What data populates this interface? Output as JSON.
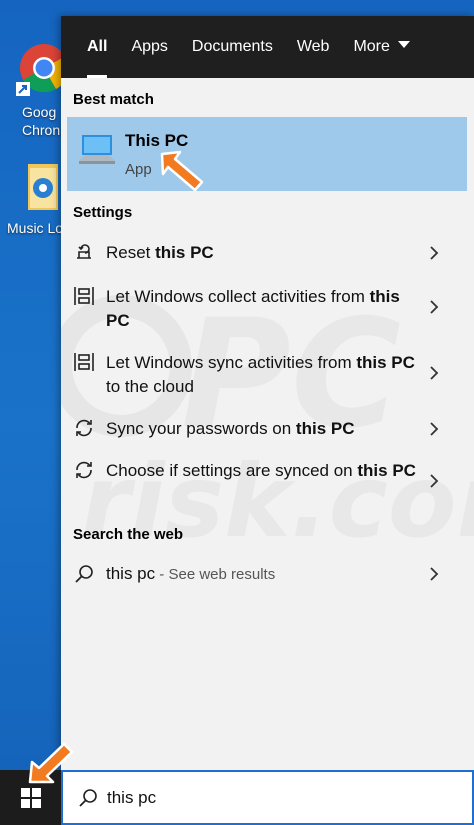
{
  "desktop": {
    "icons": [
      {
        "label_line1": "Goog",
        "label_line2": "Chron",
        "icon": "chrome-icon"
      },
      {
        "label_line1": "Music Lo",
        "icon": "folder-icon"
      }
    ]
  },
  "tabs": [
    {
      "label": "All",
      "active": true
    },
    {
      "label": "Apps"
    },
    {
      "label": "Documents"
    },
    {
      "label": "Web"
    },
    {
      "label": "More"
    }
  ],
  "best_match": {
    "section_title": "Best match",
    "name": "This PC",
    "type": "App",
    "icon": "computer-icon"
  },
  "settings": {
    "section_title": "Settings",
    "items": [
      {
        "pre": "Reset ",
        "bold": "this PC",
        "post": "",
        "icon": "reset-icon"
      },
      {
        "pre": "Let Windows collect activities from ",
        "bold": "this PC",
        "post": "",
        "icon": "timeline-icon"
      },
      {
        "pre": "Let Windows sync activities from ",
        "bold": "this PC",
        "post": " to the cloud",
        "icon": "timeline-icon"
      },
      {
        "pre": "Sync your passwords on ",
        "bold": "this PC",
        "post": "",
        "icon": "sync-icon"
      },
      {
        "pre": "Choose if settings are synced on ",
        "bold": "this PC",
        "post": "",
        "icon": "sync-icon"
      }
    ]
  },
  "web": {
    "section_title": "Search the web",
    "query": "this pc",
    "suffix": " - See web results",
    "icon": "search-icon"
  },
  "taskbar": {
    "search_value": "this pc",
    "search_icon": "search-icon",
    "start_icon": "windows-logo-icon"
  },
  "colors": {
    "accent": "#1f6fd0",
    "highlight": "#9fc9ea",
    "tab_bar": "#1f1f1f",
    "panel": "#f2f2f2",
    "arrow": "#f27a21"
  }
}
